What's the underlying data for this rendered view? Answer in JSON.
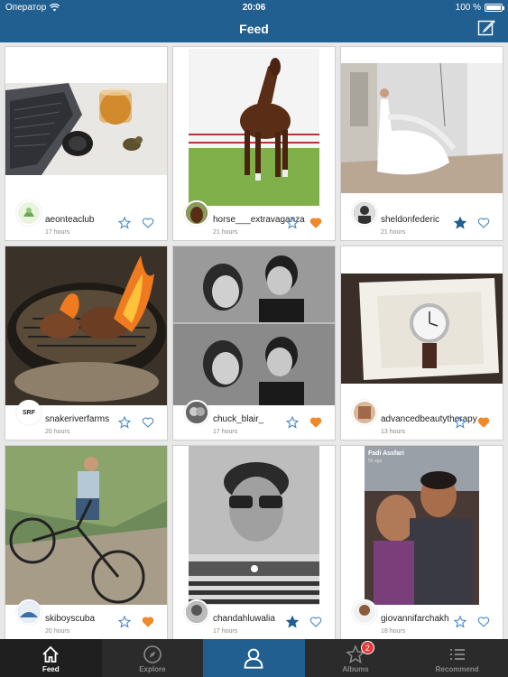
{
  "status_bar": {
    "carrier": "Оператор",
    "time": "20:06",
    "battery": "100 %",
    "battery_level": 1.0
  },
  "nav": {
    "title": "Feed"
  },
  "colors": {
    "accent": "#215f91",
    "like_active": "#f0892a",
    "tab_bg": "#2b2b2b"
  },
  "feed": [
    {
      "username": "aeonteaclub",
      "time": "17 hours",
      "starred": false,
      "liked": false
    },
    {
      "username": "horse___extravaganza",
      "time": "21 hours",
      "starred": false,
      "liked": true
    },
    {
      "username": "sheldonfederic",
      "time": "21 hours",
      "starred": true,
      "liked": false
    },
    {
      "username": "snakeriverfarms",
      "time": "20 hours",
      "starred": false,
      "liked": false
    },
    {
      "username": "chuck_blair_",
      "time": "17 hours",
      "starred": false,
      "liked": true
    },
    {
      "username": "advancedbeautytherapy",
      "time": "13 hours",
      "starred": false,
      "liked": true
    },
    {
      "username": "skiboyscuba",
      "time": "20 hours",
      "starred": false,
      "liked": true
    },
    {
      "username": "chandahluwalia",
      "time": "17 hours",
      "starred": true,
      "liked": false
    },
    {
      "username": "giovannifarchakh",
      "time": "18 hours",
      "starred": false,
      "liked": false
    }
  ],
  "photo_captions": {
    "snake_logo": "SRF",
    "fadi_name": "Fadi Assfari",
    "fadi_time": "5h ago"
  },
  "tabs": [
    {
      "label": "Feed",
      "icon": "home-icon"
    },
    {
      "label": "Explore",
      "icon": "compass-icon"
    },
    {
      "label": "",
      "icon": "profile-icon"
    },
    {
      "label": "Albums",
      "icon": "star-icon",
      "badge": "2"
    },
    {
      "label": "Recommend",
      "icon": "list-icon"
    }
  ]
}
